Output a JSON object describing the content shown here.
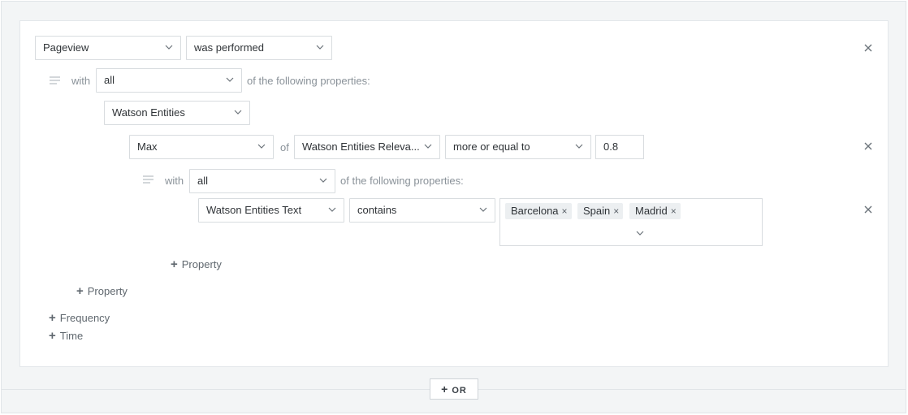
{
  "event": {
    "name": "Pageview",
    "condition": "was performed"
  },
  "group1": {
    "with_label": "with",
    "quantifier": "all",
    "suffix": "of the following properties:",
    "property": "Watson Entities",
    "aggregate": "Max",
    "of_label": "of",
    "field": "Watson Entities Releva...",
    "operator": "more or equal to",
    "value": "0.8"
  },
  "group2": {
    "with_label": "with",
    "quantifier": "all",
    "suffix": "of the following properties:",
    "property": "Watson Entities Text",
    "operator": "contains",
    "tags": [
      "Barcelona",
      "Spain",
      "Madrid"
    ],
    "tag_remove": "×"
  },
  "actions": {
    "add_property_inner": "Property",
    "add_property_outer": "Property",
    "add_frequency": "Frequency",
    "add_time": "Time",
    "plus": "+",
    "or_button": "OR"
  },
  "colors": {
    "background": "#f3f5f6",
    "card": "#ffffff",
    "border": "#d8dcdf",
    "tag": "#eceff1"
  }
}
